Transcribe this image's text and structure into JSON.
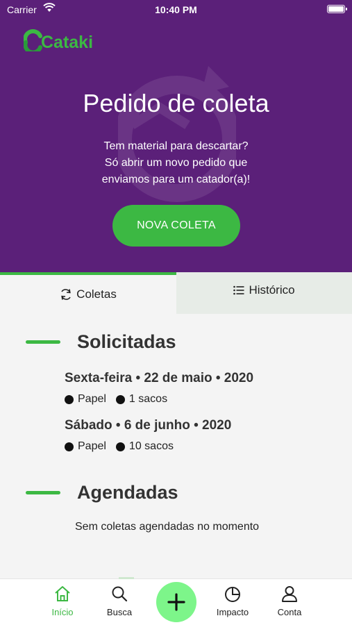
{
  "status_bar": {
    "carrier": "Carrier",
    "time": "10:40 PM"
  },
  "brand": {
    "logo_text": "Cataki",
    "accent": "#3cb843",
    "header_bg": "#5b2079"
  },
  "hero": {
    "title": "Pedido de coleta",
    "subtitle": [
      "Tem material para descartar?",
      "Só abrir um novo pedido que",
      "enviamos para um catador(a)!"
    ],
    "cta_label": "NOVA COLETA"
  },
  "tabs": [
    {
      "label": "Coletas",
      "icon": "refresh-icon",
      "active": true
    },
    {
      "label": "Histórico",
      "icon": "list-icon",
      "active": false
    }
  ],
  "sections": {
    "solicitadas": {
      "title": "Solicitadas",
      "items": [
        {
          "date": "Sexta-feira • 22 de maio • 2020",
          "material": "Papel",
          "quantity": "1 sacos"
        },
        {
          "date": "Sábado • 6 de junho • 2020",
          "material": "Papel",
          "quantity": "10 sacos"
        }
      ]
    },
    "agendadas": {
      "title": "Agendadas",
      "empty_text": "Sem coletas agendadas no momento"
    }
  },
  "bottom_nav": [
    {
      "label": "Início",
      "icon": "home-icon",
      "active": true
    },
    {
      "label": "Busca",
      "icon": "search-icon",
      "active": false
    },
    {
      "label": "",
      "icon": "plus-icon",
      "active": false
    },
    {
      "label": "Impacto",
      "icon": "pie-chart-icon",
      "active": false
    },
    {
      "label": "Conta",
      "icon": "user-icon",
      "active": false
    }
  ]
}
